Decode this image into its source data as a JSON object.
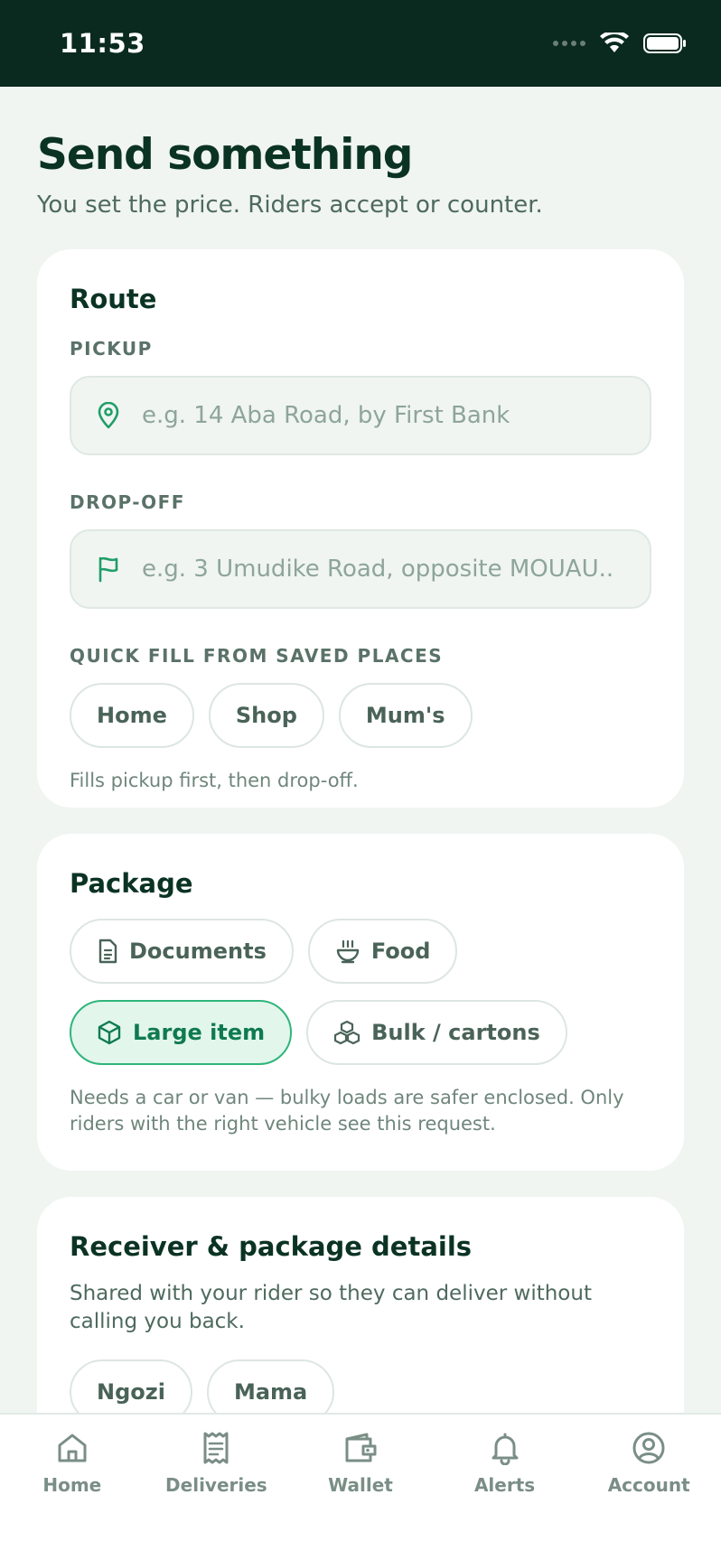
{
  "status_bar": {
    "time": "11:53"
  },
  "header": {
    "title": "Send something",
    "subtitle": "You set the price. Riders accept or counter."
  },
  "route": {
    "title": "Route",
    "pickup_label": "PICKUP",
    "pickup_placeholder": "e.g. 14 Aba Road, by First Bank",
    "dropoff_label": "DROP-OFF",
    "dropoff_placeholder": "e.g. 3 Umudike Road, opposite MOUAU...",
    "saved_places_label": "QUICK FILL FROM SAVED PLACES",
    "saved_places": [
      "Home",
      "Shop",
      "Mum's"
    ],
    "hint": "Fills pickup first, then drop-off."
  },
  "package": {
    "title": "Package",
    "options": [
      {
        "label": "Documents",
        "icon": "document-icon",
        "selected": false
      },
      {
        "label": "Food",
        "icon": "food-bowl-icon",
        "selected": false
      },
      {
        "label": "Large item",
        "icon": "box-icon",
        "selected": true
      },
      {
        "label": "Bulk / cartons",
        "icon": "cartons-icon",
        "selected": false
      }
    ],
    "hint": "Needs a car or van — bulky loads are safer enclosed. Only riders with the right vehicle see this request."
  },
  "receiver": {
    "title": "Receiver & package details",
    "description": "Shared with your rider so they can deliver without calling you back.",
    "contacts": [
      "Ngozi",
      "Mama"
    ]
  },
  "bottom_nav": {
    "items": [
      {
        "label": "Home",
        "icon": "home-icon"
      },
      {
        "label": "Deliveries",
        "icon": "receipt-icon"
      },
      {
        "label": "Wallet",
        "icon": "wallet-icon"
      },
      {
        "label": "Alerts",
        "icon": "bell-icon"
      },
      {
        "label": "Account",
        "icon": "account-icon"
      }
    ]
  },
  "colors": {
    "status_bar": "#0a2a20",
    "background": "#f0f5f2",
    "accent": "#2fb57a",
    "heading": "#0b3324"
  }
}
